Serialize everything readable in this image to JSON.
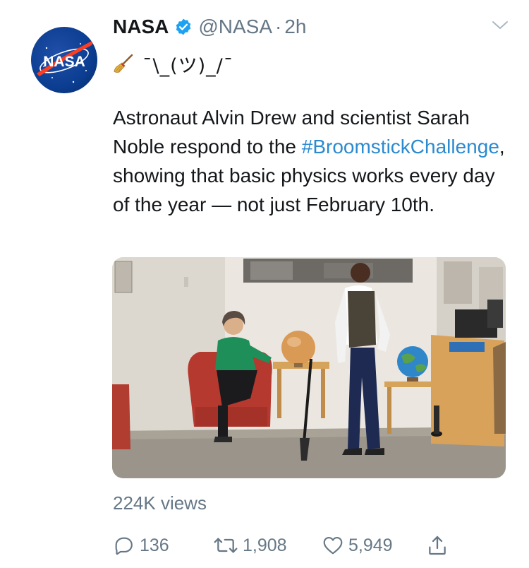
{
  "tweet": {
    "author_name": "NASA",
    "handle": "@NASA",
    "separator": "·",
    "time": "2h",
    "avatar_text": "NASA",
    "emoji_icon": "broom-emoji",
    "shrug": "¯\\_(ツ)_/¯",
    "text_part1": "Astronaut Alvin Drew and scientist Sarah Noble respond to the ",
    "hashtag": "#BroomstickChallenge",
    "text_part2": ", showing that basic physics works every day of the year — not just February 10th.",
    "views": "224K views"
  },
  "actions": {
    "reply_count": "136",
    "retweet_count": "1,908",
    "like_count": "5,949"
  },
  "icons": {
    "verified": "verified-badge-icon",
    "menu": "chevron-down-icon",
    "reply": "reply-icon",
    "retweet": "retweet-icon",
    "like": "heart-icon",
    "share": "share-icon"
  },
  "colors": {
    "text": "#14171a",
    "secondary": "#657786",
    "link": "#2b8ad0",
    "verified": "#1da1f2",
    "nasa_blue": "#0b3d91",
    "nasa_red": "#fc3d21"
  }
}
